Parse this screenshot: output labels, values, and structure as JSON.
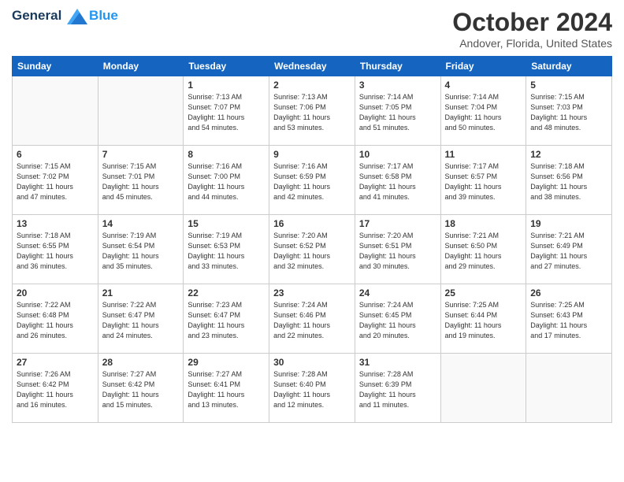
{
  "header": {
    "logo_line1": "General",
    "logo_line2": "Blue",
    "month_title": "October 2024",
    "location": "Andover, Florida, United States"
  },
  "weekdays": [
    "Sunday",
    "Monday",
    "Tuesday",
    "Wednesday",
    "Thursday",
    "Friday",
    "Saturday"
  ],
  "weeks": [
    [
      {
        "day": "",
        "sunrise": "",
        "sunset": "",
        "daylight": ""
      },
      {
        "day": "",
        "sunrise": "",
        "sunset": "",
        "daylight": ""
      },
      {
        "day": "1",
        "sunrise": "Sunrise: 7:13 AM",
        "sunset": "Sunset: 7:07 PM",
        "daylight": "Daylight: 11 hours and 54 minutes."
      },
      {
        "day": "2",
        "sunrise": "Sunrise: 7:13 AM",
        "sunset": "Sunset: 7:06 PM",
        "daylight": "Daylight: 11 hours and 53 minutes."
      },
      {
        "day": "3",
        "sunrise": "Sunrise: 7:14 AM",
        "sunset": "Sunset: 7:05 PM",
        "daylight": "Daylight: 11 hours and 51 minutes."
      },
      {
        "day": "4",
        "sunrise": "Sunrise: 7:14 AM",
        "sunset": "Sunset: 7:04 PM",
        "daylight": "Daylight: 11 hours and 50 minutes."
      },
      {
        "day": "5",
        "sunrise": "Sunrise: 7:15 AM",
        "sunset": "Sunset: 7:03 PM",
        "daylight": "Daylight: 11 hours and 48 minutes."
      }
    ],
    [
      {
        "day": "6",
        "sunrise": "Sunrise: 7:15 AM",
        "sunset": "Sunset: 7:02 PM",
        "daylight": "Daylight: 11 hours and 47 minutes."
      },
      {
        "day": "7",
        "sunrise": "Sunrise: 7:15 AM",
        "sunset": "Sunset: 7:01 PM",
        "daylight": "Daylight: 11 hours and 45 minutes."
      },
      {
        "day": "8",
        "sunrise": "Sunrise: 7:16 AM",
        "sunset": "Sunset: 7:00 PM",
        "daylight": "Daylight: 11 hours and 44 minutes."
      },
      {
        "day": "9",
        "sunrise": "Sunrise: 7:16 AM",
        "sunset": "Sunset: 6:59 PM",
        "daylight": "Daylight: 11 hours and 42 minutes."
      },
      {
        "day": "10",
        "sunrise": "Sunrise: 7:17 AM",
        "sunset": "Sunset: 6:58 PM",
        "daylight": "Daylight: 11 hours and 41 minutes."
      },
      {
        "day": "11",
        "sunrise": "Sunrise: 7:17 AM",
        "sunset": "Sunset: 6:57 PM",
        "daylight": "Daylight: 11 hours and 39 minutes."
      },
      {
        "day": "12",
        "sunrise": "Sunrise: 7:18 AM",
        "sunset": "Sunset: 6:56 PM",
        "daylight": "Daylight: 11 hours and 38 minutes."
      }
    ],
    [
      {
        "day": "13",
        "sunrise": "Sunrise: 7:18 AM",
        "sunset": "Sunset: 6:55 PM",
        "daylight": "Daylight: 11 hours and 36 minutes."
      },
      {
        "day": "14",
        "sunrise": "Sunrise: 7:19 AM",
        "sunset": "Sunset: 6:54 PM",
        "daylight": "Daylight: 11 hours and 35 minutes."
      },
      {
        "day": "15",
        "sunrise": "Sunrise: 7:19 AM",
        "sunset": "Sunset: 6:53 PM",
        "daylight": "Daylight: 11 hours and 33 minutes."
      },
      {
        "day": "16",
        "sunrise": "Sunrise: 7:20 AM",
        "sunset": "Sunset: 6:52 PM",
        "daylight": "Daylight: 11 hours and 32 minutes."
      },
      {
        "day": "17",
        "sunrise": "Sunrise: 7:20 AM",
        "sunset": "Sunset: 6:51 PM",
        "daylight": "Daylight: 11 hours and 30 minutes."
      },
      {
        "day": "18",
        "sunrise": "Sunrise: 7:21 AM",
        "sunset": "Sunset: 6:50 PM",
        "daylight": "Daylight: 11 hours and 29 minutes."
      },
      {
        "day": "19",
        "sunrise": "Sunrise: 7:21 AM",
        "sunset": "Sunset: 6:49 PM",
        "daylight": "Daylight: 11 hours and 27 minutes."
      }
    ],
    [
      {
        "day": "20",
        "sunrise": "Sunrise: 7:22 AM",
        "sunset": "Sunset: 6:48 PM",
        "daylight": "Daylight: 11 hours and 26 minutes."
      },
      {
        "day": "21",
        "sunrise": "Sunrise: 7:22 AM",
        "sunset": "Sunset: 6:47 PM",
        "daylight": "Daylight: 11 hours and 24 minutes."
      },
      {
        "day": "22",
        "sunrise": "Sunrise: 7:23 AM",
        "sunset": "Sunset: 6:47 PM",
        "daylight": "Daylight: 11 hours and 23 minutes."
      },
      {
        "day": "23",
        "sunrise": "Sunrise: 7:24 AM",
        "sunset": "Sunset: 6:46 PM",
        "daylight": "Daylight: 11 hours and 22 minutes."
      },
      {
        "day": "24",
        "sunrise": "Sunrise: 7:24 AM",
        "sunset": "Sunset: 6:45 PM",
        "daylight": "Daylight: 11 hours and 20 minutes."
      },
      {
        "day": "25",
        "sunrise": "Sunrise: 7:25 AM",
        "sunset": "Sunset: 6:44 PM",
        "daylight": "Daylight: 11 hours and 19 minutes."
      },
      {
        "day": "26",
        "sunrise": "Sunrise: 7:25 AM",
        "sunset": "Sunset: 6:43 PM",
        "daylight": "Daylight: 11 hours and 17 minutes."
      }
    ],
    [
      {
        "day": "27",
        "sunrise": "Sunrise: 7:26 AM",
        "sunset": "Sunset: 6:42 PM",
        "daylight": "Daylight: 11 hours and 16 minutes."
      },
      {
        "day": "28",
        "sunrise": "Sunrise: 7:27 AM",
        "sunset": "Sunset: 6:42 PM",
        "daylight": "Daylight: 11 hours and 15 minutes."
      },
      {
        "day": "29",
        "sunrise": "Sunrise: 7:27 AM",
        "sunset": "Sunset: 6:41 PM",
        "daylight": "Daylight: 11 hours and 13 minutes."
      },
      {
        "day": "30",
        "sunrise": "Sunrise: 7:28 AM",
        "sunset": "Sunset: 6:40 PM",
        "daylight": "Daylight: 11 hours and 12 minutes."
      },
      {
        "day": "31",
        "sunrise": "Sunrise: 7:28 AM",
        "sunset": "Sunset: 6:39 PM",
        "daylight": "Daylight: 11 hours and 11 minutes."
      },
      {
        "day": "",
        "sunrise": "",
        "sunset": "",
        "daylight": ""
      },
      {
        "day": "",
        "sunrise": "",
        "sunset": "",
        "daylight": ""
      }
    ]
  ]
}
